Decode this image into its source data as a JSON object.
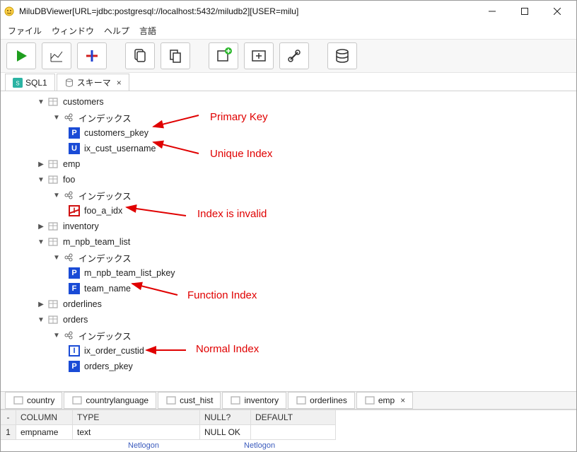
{
  "titlebar": {
    "title": "MiluDBViewer[URL=jdbc:postgresql://localhost:5432/miludb2][USER=milu]"
  },
  "menu": {
    "file": "ファイル",
    "window": "ウィンドウ",
    "help": "ヘルプ",
    "lang": "言語"
  },
  "tabs_top": {
    "sql": "SQL1",
    "schema": "スキーマ",
    "close": "×"
  },
  "tree": {
    "customers": "customers",
    "index_label": "インデックス",
    "customers_pkey": "customers_pkey",
    "ix_cust_username": "ix_cust_username",
    "emp": "emp",
    "foo": "foo",
    "foo_a_idx": "foo_a_idx",
    "inventory": "inventory",
    "m_npb_team_list": "m_npb_team_list",
    "m_npb_team_list_pkey": "m_npb_team_list_pkey",
    "team_name": "team_name",
    "orderlines": "orderlines",
    "orders": "orders",
    "ix_order_custid": "ix_order_custid",
    "orders_pkey": "orders_pkey"
  },
  "annot": {
    "pk": "Primary Key",
    "uq": "Unique Index",
    "inv": "Index is invalid",
    "fn": "Function Index",
    "nm": "Normal Index"
  },
  "tabs_bottom": {
    "country": "country",
    "countrylanguage": "countrylanguage",
    "cust_hist": "cust_hist",
    "inventory": "inventory",
    "orderlines": "orderlines",
    "emp": "emp",
    "close": "×"
  },
  "grid": {
    "h_rownum": "-",
    "h_col": "COLUMN",
    "h_type": "TYPE",
    "h_null": "NULL?",
    "h_default": "DEFAULT",
    "r1": "1",
    "c1": "empname",
    "t1": "text",
    "n1": "NULL OK",
    "d1": ""
  },
  "status": {
    "a": "Netlogon",
    "b": "Netlogon"
  }
}
